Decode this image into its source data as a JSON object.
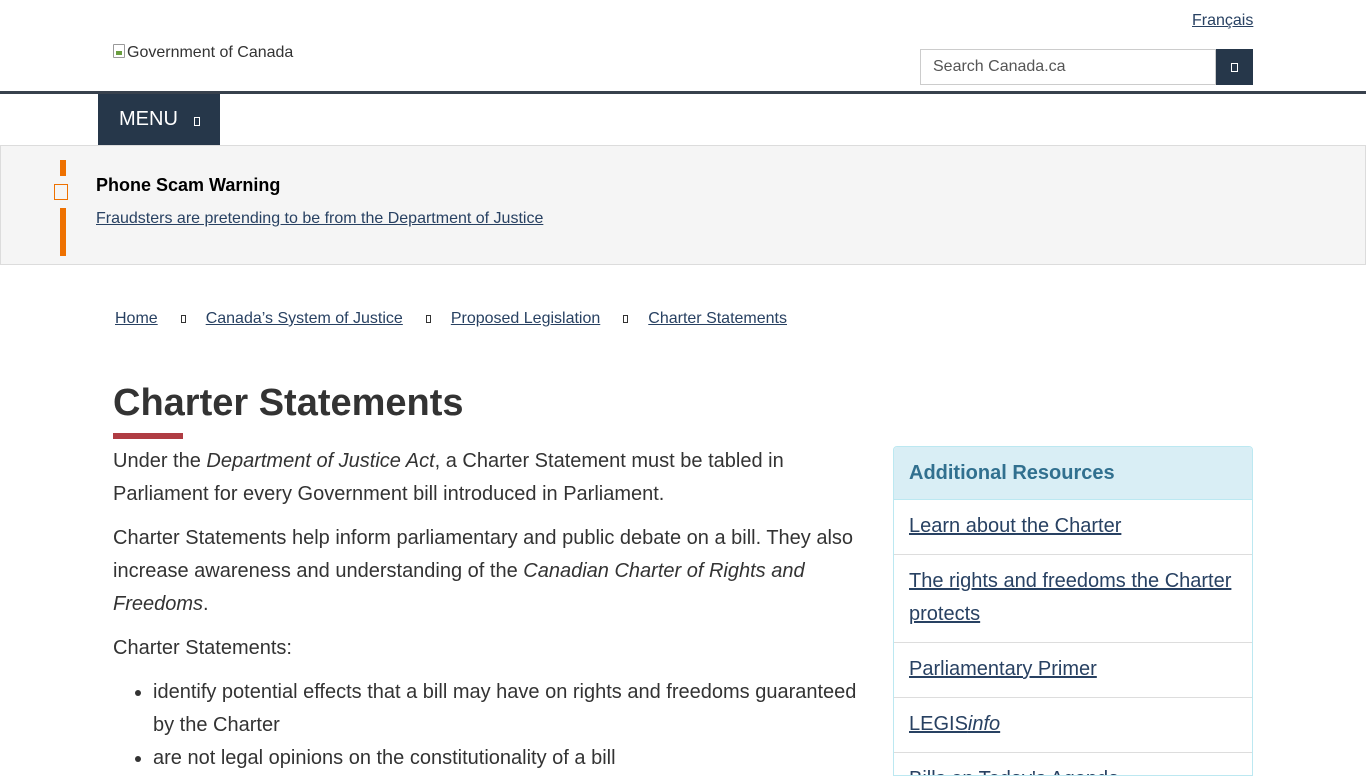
{
  "header": {
    "language_link": "Français",
    "logo_alt": "Government of Canada",
    "search": {
      "placeholder": "Search Canada.ca"
    },
    "menu_label": "MENU"
  },
  "alert": {
    "title": "Phone Scam Warning",
    "link": "Fraudsters are pretending to be from the Department of Justice"
  },
  "breadcrumb": [
    {
      "label": "Home"
    },
    {
      "label": "Canada’s System of Justice"
    },
    {
      "label": "Proposed Legislation"
    },
    {
      "label": "Charter Statements"
    }
  ],
  "main": {
    "title": "Charter Statements",
    "p1": {
      "before": "Under the ",
      "italic": "Department of Justice Act",
      "after": ", a Charter Statement must be  tabled in Parliament for every Government bill introduced in Parliament."
    },
    "p2": {
      "before": "Charter Statements help inform parliamentary and public debate on a bill. They also increase awareness and understanding of the ",
      "italic": "Canadian Charter of Rights and Freedoms",
      "after": "."
    },
    "p3": "Charter Statements:",
    "list": [
      "identify potential effects that a bill may have on rights and freedoms guaranteed by the Charter",
      "are not legal opinions on the constitutionality of a bill"
    ]
  },
  "aside": {
    "title": "Additional Resources",
    "items": [
      {
        "label": "Learn about the Charter"
      },
      {
        "label": "The rights and freedoms the Charter protects"
      },
      {
        "label": "Parliamentary Primer"
      },
      {
        "label_plain": "LEGIS",
        "label_italic": "info"
      },
      {
        "label": "Bills on Today's Agenda"
      }
    ]
  },
  "colors": {
    "header_dark": "#26374a",
    "link": "#284162",
    "alert_accent": "#ee7100",
    "title_rule": "#af3c43",
    "aside_header_bg": "#d9eef5",
    "aside_title": "#31708f"
  }
}
